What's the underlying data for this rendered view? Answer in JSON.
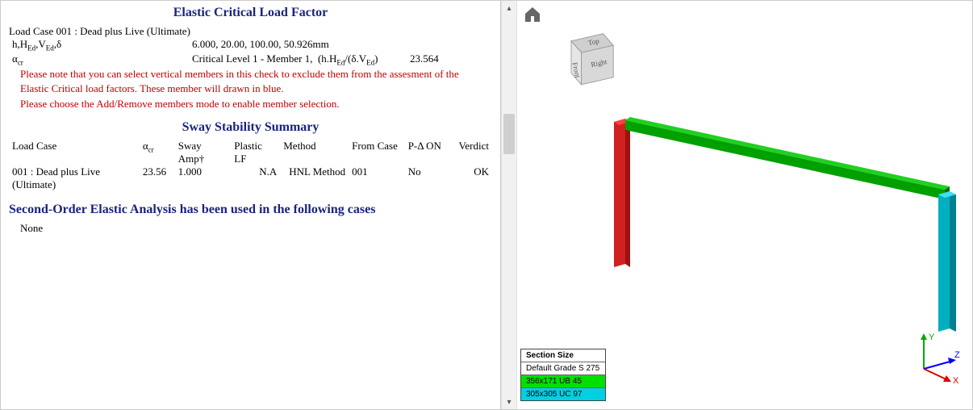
{
  "titles": {
    "elastic_critical": "Elastic Critical Load Factor",
    "sway_summary": "Sway Stability Summary",
    "second_order": "Second-Order Elastic Analysis has been used in the following cases"
  },
  "elastic": {
    "load_case_line": "Load Case 001 : Dead plus Live (Ultimate)",
    "params_label": "h,H_Ed,V_Ed,δ",
    "params_values": "6.000, 20.00, 100.00, 50.926mm",
    "alpha_label": "α_cr",
    "crit_level_label": "Critical Level 1 - Member 1,  (h.H_Ed/(δ.V_Ed)",
    "crit_level_value": "23.564",
    "note_line1": "Please note that you can select vertical members in this check to exclude them from the assesment of the",
    "note_line2": "Elastic Critical load factors. These member will drawn in blue.",
    "note_line3": "Please choose the Add/Remove members mode to enable member selection."
  },
  "sway": {
    "headers": {
      "load_case": "Load Case",
      "alpha_cr": "α_cr",
      "sway_amp": "Sway Amp†",
      "plastic_lf": "Plastic LF",
      "method": "Method",
      "from_case": "From Case",
      "pdelta": "P-Δ ON",
      "verdict": "Verdict"
    },
    "rows": [
      {
        "load_case": "001 : Dead plus Live (Ultimate)",
        "alpha_cr": "23.56",
        "sway_amp": "1.000",
        "plastic_lf": "N.A",
        "method": "HNL Method",
        "from_case": "001",
        "pdelta": "No",
        "verdict": "OK"
      }
    ]
  },
  "second_order": {
    "none_text": "None"
  },
  "viewport": {
    "home_icon": "home-icon",
    "viewcube": {
      "top": "Top",
      "front": "Front",
      "right": "Right"
    },
    "axes": {
      "x": "X",
      "y": "Y",
      "z": "Z"
    },
    "legend": {
      "header": "Section Size",
      "default_row": "Default Grade S 275",
      "rows": [
        {
          "label": "356x171 UB 45",
          "color": "#00e000"
        },
        {
          "label": "305x305 UC 97",
          "color": "#00d0e0"
        }
      ]
    },
    "members": {
      "left_column_color": "#d02020",
      "beam_color": "#00a000",
      "right_column_color": "#00b0c0"
    }
  }
}
